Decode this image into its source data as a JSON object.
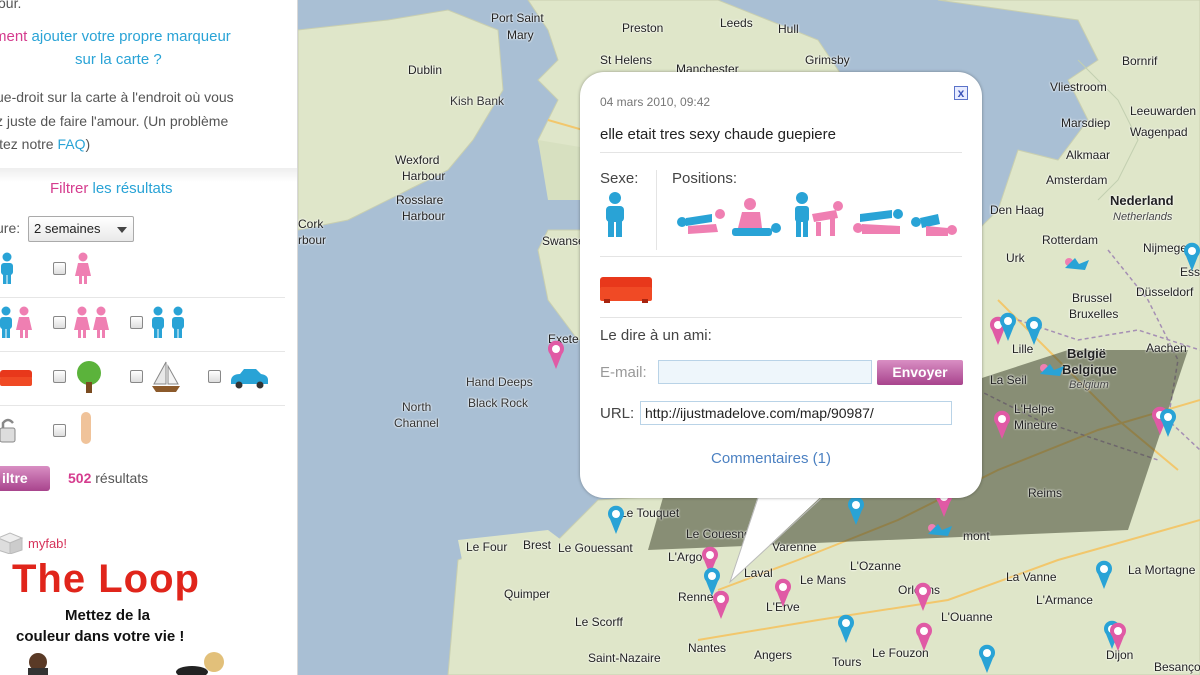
{
  "sidebar": {
    "intro_prefix": "ment",
    "intro_link_1": "ajouter votre propre marqueur",
    "intro_link_2": "sur la carte ?",
    "top_fragment": "our.",
    "help_line_1": "ue-droit sur la carte à l'endroit où vous",
    "help_line_2": "z juste de faire l'amour. (Un problème",
    "help_line_3_prefix": "itez notre",
    "help_link": "FAQ",
    "help_line_3_suffix": ")",
    "filter_title_pink": "Filtrer",
    "filter_title_blue": "les résultats",
    "period_label": "ure:",
    "period_value": "2 semaines",
    "filter_button": "iltre",
    "results_count": "502",
    "results_label": "résultats"
  },
  "ad": {
    "brand": "myfab!",
    "title": "The Loop",
    "line_1": "Mettez de la",
    "line_2": "couleur dans votre vie !"
  },
  "map": {
    "cities": [
      "Port Saint",
      "Mary",
      "Preston",
      "Leeds",
      "Hull",
      "St Helens",
      "Manchester",
      "Grimsby",
      "Dublin",
      "Kish Bank",
      "Wexford",
      "Harbour",
      "Rosslare",
      "Harbour",
      "Cork",
      "rbour",
      "Swansea",
      "Exete",
      "Hand Deeps",
      "Black Rock",
      "North",
      "Channel",
      "Vliestroom",
      "Bornrif",
      "Leeuwarden",
      "Marsdiep",
      "Wagenpad",
      "Alkmaar",
      "Amsterdam",
      "Den Haag",
      "Nederland",
      "Netherlands",
      "Rotterdam",
      "Urk",
      "Nijmegen",
      "Ess",
      "Brussel",
      "Bruxelles",
      "Düsseldorf",
      "Lille",
      "Aachen",
      "België",
      "Belgique",
      "Belgium",
      "La Seil",
      "L'Helpe",
      "Mineure",
      "Reims",
      "Le Touquet",
      "Le Couesnon",
      "Varenne",
      "Le Four",
      "Brest",
      "Le Gouessant",
      "L'Argo",
      "Laval",
      "Le Mans",
      "L'Ozanne",
      "Quimper",
      "Renne",
      "L'Erve",
      "Orléans",
      "Le Scorff",
      "L'Ouanne",
      "Nantes",
      "Angers",
      "Tours",
      "Le Fouzon",
      "Saint-Nazaire",
      "La Vanne",
      "La Mortagne",
      "L'Armance",
      "Dijon",
      "Besançon",
      "mont"
    ],
    "markers": [
      "pink",
      "blue",
      "pink",
      "blue",
      "pink",
      "pink",
      "blue",
      "pink",
      "blue",
      "pink",
      "blue",
      "blue",
      "pink",
      "blue",
      "pink",
      "blue",
      "pink",
      "pink",
      "blue",
      "blue",
      "pink",
      "blue"
    ]
  },
  "infowindow": {
    "date": "04 mars 2010, 09:42",
    "message": "elle etait tres sexy chaude guepiere",
    "sexe_label": "Sexe:",
    "positions_label": "Positions:",
    "share_label": "Le dire à un ami:",
    "email_label": "E-mail:",
    "email_value": "",
    "send_button": "Envoyer",
    "url_label": "URL:",
    "url_value": "http://ijustmadelove.com/map/90987/",
    "comments_link": "Commentaires (1)",
    "close_symbol": "x"
  },
  "colors": {
    "accent_blue": "#29a3d6",
    "accent_pink": "#d53c8e",
    "button_pink": "#b55c9d",
    "sea": "#a9bfd4",
    "land": "#dfe6c9",
    "link_blue": "#4c81c2"
  }
}
